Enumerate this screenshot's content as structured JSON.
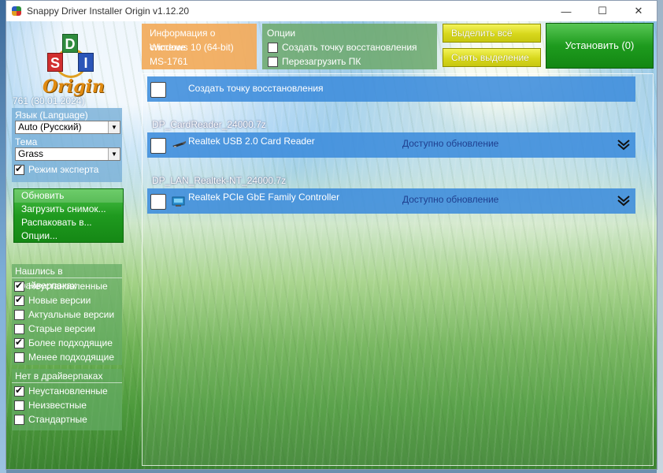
{
  "window": {
    "title": "Snappy Driver Installer Origin v1.12.20",
    "controls": {
      "minimize": "—",
      "maximize": "☐",
      "close": "✕"
    }
  },
  "logo": {
    "d": "D",
    "s": "S",
    "i": "I",
    "origin": "Origin"
  },
  "version": "761 (30.01.2024)",
  "language": {
    "label": "Язык (Language)",
    "selected": "Auto (Русский)"
  },
  "theme": {
    "label": "Тема",
    "selected": "Grass"
  },
  "expert_mode": {
    "label": "Режим эксперта",
    "checked": true
  },
  "menu": {
    "items": [
      "Обновить",
      "Загрузить снимок...",
      "Распаковать в...",
      "Опции..."
    ]
  },
  "found_in_packs": {
    "title": "Нашлись в драйверпаках",
    "items": [
      {
        "label": "Неустановленные",
        "checked": true
      },
      {
        "label": "Новые версии",
        "checked": true
      },
      {
        "label": "Актуальные версии",
        "checked": false
      },
      {
        "label": "Старые версии",
        "checked": false
      },
      {
        "label": "Более подходящие",
        "checked": true
      },
      {
        "label": "Менее подходящие",
        "checked": false
      }
    ]
  },
  "not_in_packs": {
    "title": "Нет в драйверпаках",
    "items": [
      {
        "label": "Неустановленные",
        "checked": true
      },
      {
        "label": "Неизвестные",
        "checked": false
      },
      {
        "label": "Стандартные",
        "checked": false
      }
    ]
  },
  "system_info": {
    "title": "Информация о системе",
    "os": "Windows 10 (64-bit)",
    "model": "MS-1761"
  },
  "options": {
    "title": "Опции",
    "restore_point": "Создать точку восстановления",
    "reboot": "Перезагрузить ПК"
  },
  "buttons": {
    "select_all": "Выделить всё",
    "deselect": "Снять выделение",
    "install": "Установить (0)"
  },
  "list": {
    "restore_point_row": "Создать точку восстановления",
    "groups": [
      {
        "pack": "DP_CardReader_24000.7z",
        "device": "Realtek USB 2.0 Card Reader",
        "status": "Доступно обновление",
        "icon": "usb-card-reader-icon"
      },
      {
        "pack": "DP_LAN_Realtek-NT_24000.7z",
        "device": "Realtek PCIe GbE Family Controller",
        "status": "Доступно обновление",
        "icon": "network-adapter-icon"
      }
    ]
  },
  "colors": {
    "info_orange": "#f2aa5a",
    "options_green": "#6eaa6e",
    "install_green": "#1e9b1e",
    "select_yellow": "#d7d71c",
    "bar_blue": "#3c8cdc",
    "status_text": "#1f3f8f"
  }
}
